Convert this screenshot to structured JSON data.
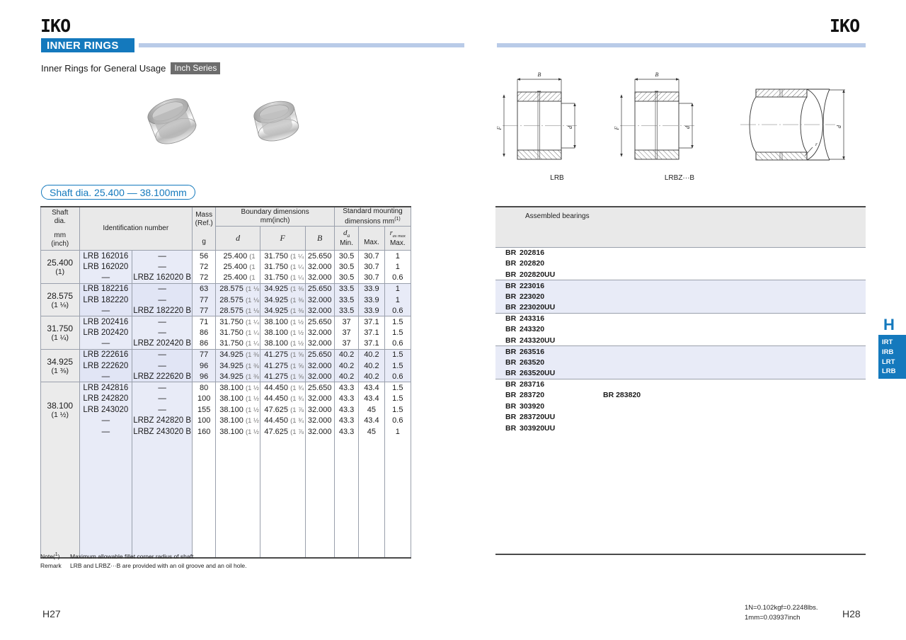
{
  "brand": {
    "logo_text": "IKO"
  },
  "header": {
    "section_banner": "INNER RINGS",
    "subtitle": "Inner Rings for General Usage",
    "series_tag": "Inch Series",
    "shaft_dia_range": "Shaft dia. 25.400 — 38.100mm"
  },
  "diagrams": {
    "caption_lrb": "LRB",
    "caption_lrbzb": "LRBZ···B",
    "labels": {
      "width": "B",
      "bore": "d",
      "outer": "F",
      "radius": "r"
    }
  },
  "spec_table": {
    "headers": {
      "shaft_dia": "Shaft\ndia.",
      "shaft_dia_units": "mm\n(inch)",
      "identification_number": "Identification number",
      "mass": "Mass\n(Ref.)",
      "mass_unit": "g",
      "boundary": "Boundary dimensions",
      "boundary_unit": "mm(inch)",
      "d": "d",
      "F": "F",
      "B": "B",
      "mounting": "Standard mounting",
      "mounting_unit": "dimensions    mm",
      "da": "d",
      "da_sub": "a",
      "da_min": "Min.",
      "da_max": "Max.",
      "ras": "r",
      "ras_sub": "as max",
      "ras_max": "Max.",
      "footnote_marker": "(1)"
    },
    "groups": [
      {
        "shaft_mm": "25.400",
        "shaft_inch": "(1)",
        "banded": false,
        "rows": [
          {
            "idn1": "LRB 162016",
            "idn2": "—",
            "mass": "56",
            "d": "25.400",
            "d_inch": "(1",
            "F": "31.750",
            "F_inch": "(1 ¼",
            "B": "25.650",
            "da_min": "30.5",
            "da_max": "30.7",
            "ras": "1"
          },
          {
            "idn1": "LRB 162020",
            "idn2": "—",
            "mass": "72",
            "d": "25.400",
            "d_inch": "(1",
            "F": "31.750",
            "F_inch": "(1 ¼",
            "B": "32.000",
            "da_min": "30.5",
            "da_max": "30.7",
            "ras": "1"
          },
          {
            "idn1": "—",
            "idn2": "LRBZ 162020 B",
            "mass": "72",
            "d": "25.400",
            "d_inch": "(1",
            "F": "31.750",
            "F_inch": "(1 ¼",
            "B": "32.000",
            "da_min": "30.5",
            "da_max": "30.7",
            "ras": "0.6"
          }
        ]
      },
      {
        "shaft_mm": "28.575",
        "shaft_inch": "(1 ⅛)",
        "banded": true,
        "rows": [
          {
            "idn1": "LRB 182216",
            "idn2": "—",
            "mass": "63",
            "d": "28.575",
            "d_inch": "(1 ⅛",
            "F": "34.925",
            "F_inch": "(1 ⅜",
            "B": "25.650",
            "da_min": "33.5",
            "da_max": "33.9",
            "ras": "1"
          },
          {
            "idn1": "LRB 182220",
            "idn2": "—",
            "mass": "77",
            "d": "28.575",
            "d_inch": "(1 ⅛",
            "F": "34.925",
            "F_inch": "(1 ⅜",
            "B": "32.000",
            "da_min": "33.5",
            "da_max": "33.9",
            "ras": "1"
          },
          {
            "idn1": "—",
            "idn2": "LRBZ 182220 B",
            "mass": "77",
            "d": "28.575",
            "d_inch": "(1 ⅛",
            "F": "34.925",
            "F_inch": "(1 ⅜",
            "B": "32.000",
            "da_min": "33.5",
            "da_max": "33.9",
            "ras": "0.6"
          }
        ]
      },
      {
        "shaft_mm": "31.750",
        "shaft_inch": "(1 ¼)",
        "banded": false,
        "rows": [
          {
            "idn1": "LRB 202416",
            "idn2": "—",
            "mass": "71",
            "d": "31.750",
            "d_inch": "(1 ¼",
            "F": "38.100",
            "F_inch": "(1 ½",
            "B": "25.650",
            "da_min": "37",
            "da_max": "37.1",
            "ras": "1.5"
          },
          {
            "idn1": "LRB 202420",
            "idn2": "—",
            "mass": "86",
            "d": "31.750",
            "d_inch": "(1 ¼",
            "F": "38.100",
            "F_inch": "(1 ½",
            "B": "32.000",
            "da_min": "37",
            "da_max": "37.1",
            "ras": "1.5"
          },
          {
            "idn1": "—",
            "idn2": "LRBZ 202420 B",
            "mass": "86",
            "d": "31.750",
            "d_inch": "(1 ¼",
            "F": "38.100",
            "F_inch": "(1 ½",
            "B": "32.000",
            "da_min": "37",
            "da_max": "37.1",
            "ras": "0.6"
          }
        ]
      },
      {
        "shaft_mm": "34.925",
        "shaft_inch": "(1 ⅜)",
        "banded": true,
        "rows": [
          {
            "idn1": "LRB 222616",
            "idn2": "—",
            "mass": "77",
            "d": "34.925",
            "d_inch": "(1 ⅜",
            "F": "41.275",
            "F_inch": "(1 ⅝",
            "B": "25.650",
            "da_min": "40.2",
            "da_max": "40.2",
            "ras": "1.5"
          },
          {
            "idn1": "LRB 222620",
            "idn2": "—",
            "mass": "96",
            "d": "34.925",
            "d_inch": "(1 ⅜",
            "F": "41.275",
            "F_inch": "(1 ⅝",
            "B": "32.000",
            "da_min": "40.2",
            "da_max": "40.2",
            "ras": "1.5"
          },
          {
            "idn1": "—",
            "idn2": "LRBZ 222620 B",
            "mass": "96",
            "d": "34.925",
            "d_inch": "(1 ⅜",
            "F": "41.275",
            "F_inch": "(1 ⅝",
            "B": "32.000",
            "da_min": "40.2",
            "da_max": "40.2",
            "ras": "0.6"
          }
        ]
      },
      {
        "shaft_mm": "38.100",
        "shaft_inch": "(1 ½)",
        "banded": false,
        "rows": [
          {
            "idn1": "LRB 242816",
            "idn2": "—",
            "mass": "80",
            "d": "38.100",
            "d_inch": "(1 ½",
            "F": "44.450",
            "F_inch": "(1 ¾",
            "B": "25.650",
            "da_min": "43.3",
            "da_max": "43.4",
            "ras": "1.5"
          },
          {
            "idn1": "LRB 242820",
            "idn2": "—",
            "mass": "100",
            "d": "38.100",
            "d_inch": "(1 ½",
            "F": "44.450",
            "F_inch": "(1 ¾",
            "B": "32.000",
            "da_min": "43.3",
            "da_max": "43.4",
            "ras": "1.5"
          },
          {
            "idn1": "LRB 243020",
            "idn2": "—",
            "mass": "155",
            "d": "38.100",
            "d_inch": "(1 ½",
            "F": "47.625",
            "F_inch": "(1 ⅞",
            "B": "32.000",
            "da_min": "43.3",
            "da_max": "45",
            "ras": "1.5"
          },
          {
            "idn1": "—",
            "idn2": "LRBZ 242820 B",
            "mass": "100",
            "d": "38.100",
            "d_inch": "(1 ½",
            "F": "44.450",
            "F_inch": "(1 ¾",
            "B": "32.000",
            "da_min": "43.3",
            "da_max": "43.4",
            "ras": "0.6"
          },
          {
            "idn1": "—",
            "idn2": "LRBZ 243020 B",
            "mass": "160",
            "d": "38.100",
            "d_inch": "(1 ½",
            "F": "47.625",
            "F_inch": "(1 ⅞",
            "B": "32.000",
            "da_min": "43.3",
            "da_max": "45",
            "ras": "1"
          }
        ]
      }
    ]
  },
  "assembled_table": {
    "header": "Assembled bearings",
    "groups": [
      {
        "banded": false,
        "rows": [
          {
            "prefix": "BR",
            "number": "202816",
            "alt": ""
          },
          {
            "prefix": "BR",
            "number": "202820",
            "alt": ""
          },
          {
            "prefix": "BR",
            "number": "202820UU",
            "alt": ""
          }
        ]
      },
      {
        "banded": true,
        "rows": [
          {
            "prefix": "BR",
            "number": "223016",
            "alt": ""
          },
          {
            "prefix": "BR",
            "number": "223020",
            "alt": ""
          },
          {
            "prefix": "BR",
            "number": "223020UU",
            "alt": ""
          }
        ]
      },
      {
        "banded": false,
        "rows": [
          {
            "prefix": "BR",
            "number": "243316",
            "alt": ""
          },
          {
            "prefix": "BR",
            "number": "243320",
            "alt": ""
          },
          {
            "prefix": "BR",
            "number": "243320UU",
            "alt": ""
          }
        ]
      },
      {
        "banded": true,
        "rows": [
          {
            "prefix": "BR",
            "number": "263516",
            "alt": ""
          },
          {
            "prefix": "BR",
            "number": "263520",
            "alt": ""
          },
          {
            "prefix": "BR",
            "number": "263520UU",
            "alt": ""
          }
        ]
      },
      {
        "banded": false,
        "rows": [
          {
            "prefix": "BR",
            "number": "283716",
            "alt": ""
          },
          {
            "prefix": "BR",
            "number": "283720",
            "alt": "BR 283820"
          },
          {
            "prefix": "BR",
            "number": "303920",
            "alt": ""
          },
          {
            "prefix": "BR",
            "number": "283720UU",
            "alt": ""
          },
          {
            "prefix": "BR",
            "number": "303920UU",
            "alt": ""
          }
        ]
      }
    ]
  },
  "notes": {
    "note_label": "Note(1)",
    "note_text": "Maximum allowable fillet corner radius of shaft",
    "remark_label": "Remark",
    "remark_text": "LRB and LRBZ···B are provided with an oil groove and an oil hole."
  },
  "side_index": {
    "letter": "H",
    "tabs": [
      "IRT",
      "IRB",
      "LRT",
      "LRB"
    ]
  },
  "footer": {
    "page_left": "H27",
    "page_right": "H28",
    "unit_line1": "1N=0.102kgf=0.2248lbs.",
    "unit_line2": "1mm=0.03937inch"
  }
}
